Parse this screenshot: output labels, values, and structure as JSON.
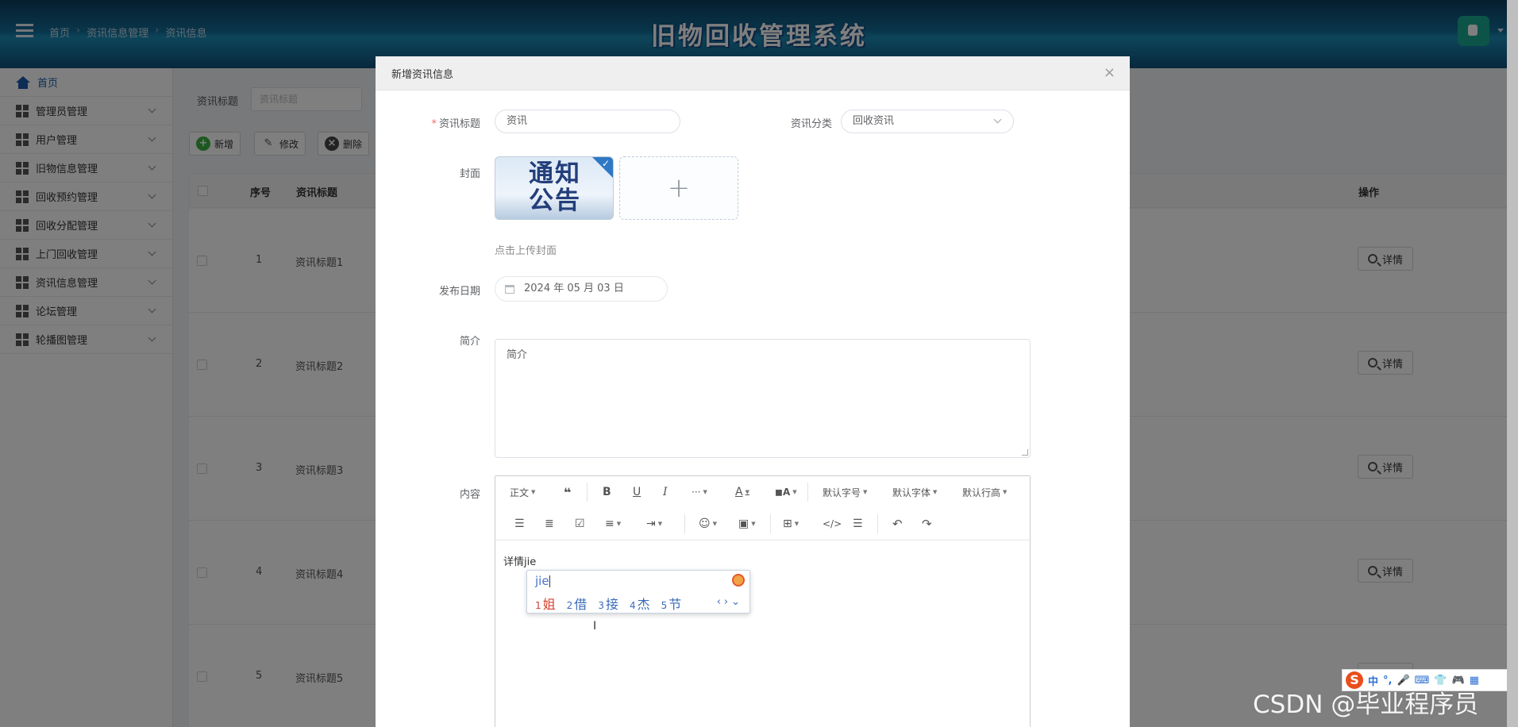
{
  "header": {
    "breadcrumb": [
      "首页",
      "资讯信息管理",
      "资讯信息"
    ],
    "title": "旧物回收管理系统"
  },
  "sidebar": {
    "items": [
      {
        "label": "首页",
        "icon": "home-icon"
      },
      {
        "label": "管理员管理",
        "icon": "grid-icon"
      },
      {
        "label": "用户管理",
        "icon": "grid-icon"
      },
      {
        "label": "旧物信息管理",
        "icon": "grid-icon"
      },
      {
        "label": "回收预约管理",
        "icon": "grid-icon"
      },
      {
        "label": "回收分配管理",
        "icon": "grid-icon"
      },
      {
        "label": "上门回收管理",
        "icon": "grid-icon"
      },
      {
        "label": "资讯信息管理",
        "icon": "grid-icon"
      },
      {
        "label": "论坛管理",
        "icon": "grid-icon"
      },
      {
        "label": "轮播图管理",
        "icon": "grid-icon"
      }
    ]
  },
  "search": {
    "label": "资讯标题",
    "placeholder": "资讯标题"
  },
  "actions": {
    "add": "新增",
    "edit": "修改",
    "delete": "删除"
  },
  "table": {
    "headers": {
      "index": "序号",
      "title": "资讯标题",
      "ops": "操作"
    },
    "rows": [
      {
        "index": "1",
        "title": "资讯标题1"
      },
      {
        "index": "2",
        "title": "资讯标题2"
      },
      {
        "index": "3",
        "title": "资讯标题3"
      },
      {
        "index": "4",
        "title": "资讯标题4"
      },
      {
        "index": "5",
        "title": "资讯标题5"
      }
    ],
    "detail_label": "详情"
  },
  "dialog": {
    "title": "新增资讯信息",
    "fields": {
      "title_label": "资讯标题",
      "title_value": "资讯",
      "category_label": "资讯分类",
      "category_value": "回收资讯",
      "cover_label": "封面",
      "cover_image_text_1": "通知",
      "cover_image_text_2": "公告",
      "upload_hint": "点击上传封面",
      "date_label": "发布日期",
      "date_value": "2024 年 05 月 03 日",
      "intro_label": "简介",
      "intro_placeholder": "简介",
      "content_label": "内容",
      "content_value": "详情jie"
    },
    "editor_toolbar": {
      "row1": {
        "paragraph": "正文",
        "font_size": "默认字号",
        "font_family": "默认字体",
        "line_height": "默认行高"
      }
    }
  },
  "ime": {
    "pinyin": "jie",
    "candidates": [
      {
        "n": "1",
        "text": "姐"
      },
      {
        "n": "2",
        "text": "借"
      },
      {
        "n": "3",
        "text": "接"
      },
      {
        "n": "4",
        "text": "杰"
      },
      {
        "n": "5",
        "text": "节"
      }
    ]
  },
  "sogou": {
    "mode": "中"
  },
  "watermark": "CSDN @毕业程序员"
}
